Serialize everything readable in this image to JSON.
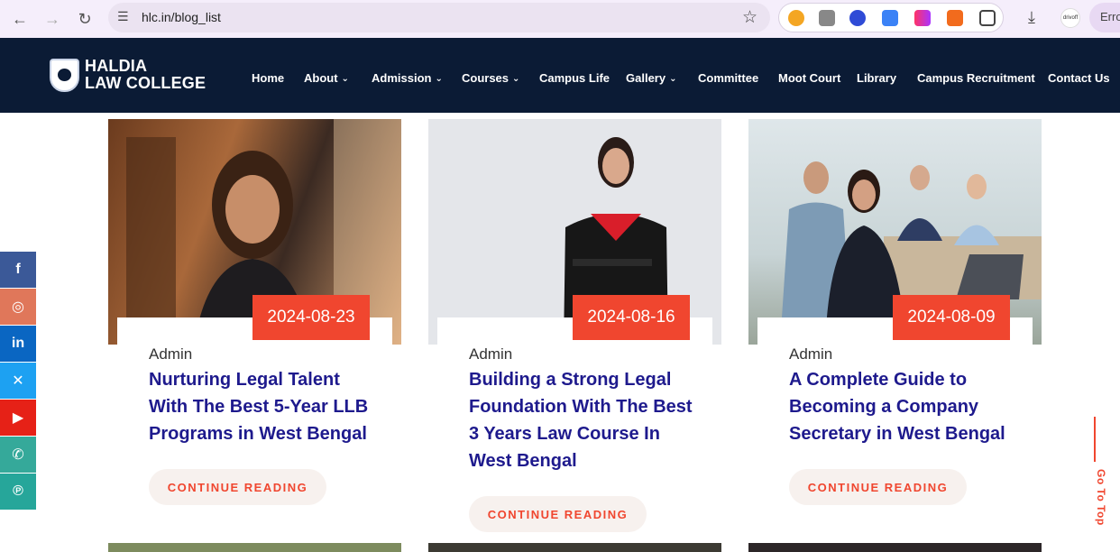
{
  "browser": {
    "url": "hlc.in/blog_list",
    "profile_label": "drivoff",
    "error_label": "Erro"
  },
  "site": {
    "logo_line1": "HALDIA",
    "logo_line2": "LAW COLLEGE",
    "menu": [
      {
        "label": "Home",
        "dropdown": false
      },
      {
        "label": "About",
        "dropdown": true
      },
      {
        "label": "Admission",
        "dropdown": true
      },
      {
        "label": "Courses",
        "dropdown": true
      },
      {
        "label": "Campus Life",
        "dropdown": false
      },
      {
        "label": "Gallery",
        "dropdown": true
      },
      {
        "label": "Committee",
        "dropdown": false
      },
      {
        "label": "Moot Court",
        "dropdown": false
      },
      {
        "label": "Library",
        "dropdown": false
      },
      {
        "label": "Campus Recruitment",
        "dropdown": false
      },
      {
        "label": "Contact Us",
        "dropdown": false
      }
    ]
  },
  "social": [
    {
      "icon": "facebook-icon",
      "glyph": "f",
      "color": "#3b5998"
    },
    {
      "icon": "instagram-icon",
      "glyph": "◎",
      "color": "#e0775a"
    },
    {
      "icon": "linkedin-icon",
      "glyph": "in",
      "color": "#0a66c2"
    },
    {
      "icon": "x-icon",
      "glyph": "✕",
      "color": "#1da1f2"
    },
    {
      "icon": "youtube-icon",
      "glyph": "▶",
      "color": "#e62117"
    },
    {
      "icon": "phone-icon",
      "glyph": "✆",
      "color": "#35a99a"
    },
    {
      "icon": "pinterest-icon",
      "glyph": "℗",
      "color": "#26a69a"
    }
  ],
  "posts": [
    {
      "date": "2024-08-23",
      "author": "Admin",
      "title": "Nurturing Legal Talent With The Best 5-Year LLB Programs in West Bengal",
      "cta": "CONTINUE READING"
    },
    {
      "date": "2024-08-16",
      "author": "Admin",
      "title": "Building a Strong Legal Foundation With The Best 3 Years Law Course In West Bengal",
      "cta": "CONTINUE READING"
    },
    {
      "date": "2024-08-09",
      "author": "Admin",
      "title": "A Complete Guide to Becoming a Company Secretary in West Bengal",
      "cta": "CONTINUE READING"
    }
  ],
  "go_to_top": "Go To Top"
}
